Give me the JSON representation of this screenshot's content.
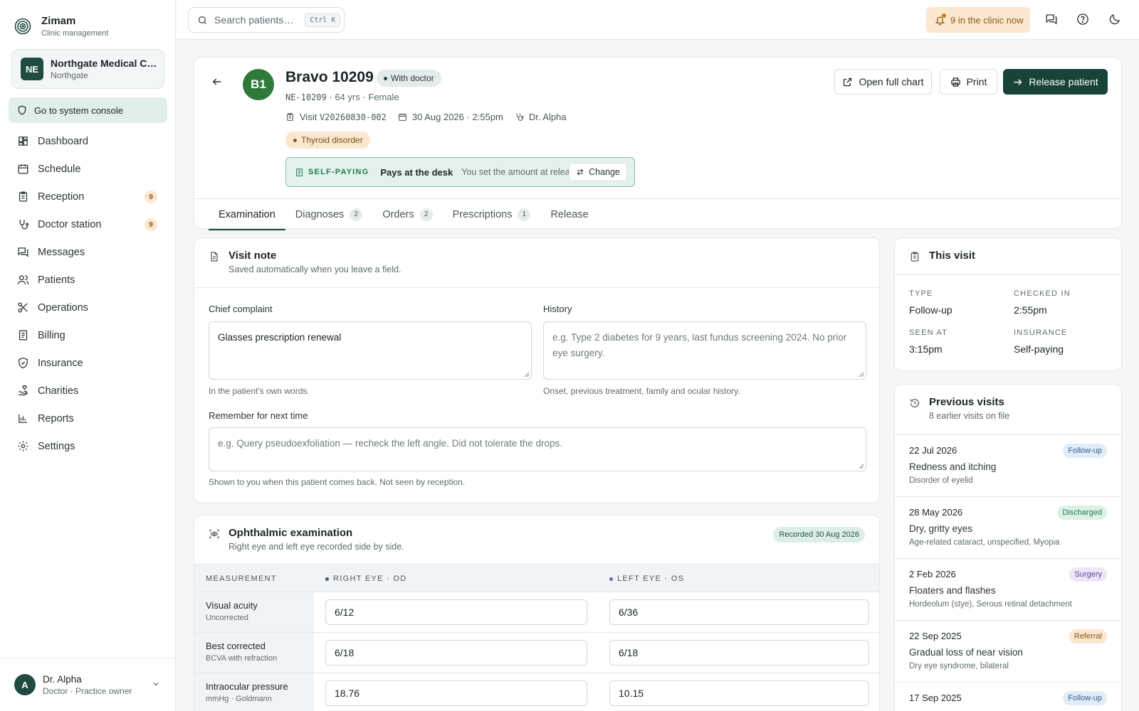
{
  "brand": {
    "name": "Zimam",
    "subtitle": "Clinic management"
  },
  "org": {
    "initials": "NE",
    "name": "Northgate Medical Ce…",
    "location": "Northgate"
  },
  "console_label": "Go to system console",
  "nav": [
    {
      "label": "Dashboard",
      "icon": "dashboard-icon",
      "badge": ""
    },
    {
      "label": "Schedule",
      "icon": "calendar-icon",
      "badge": ""
    },
    {
      "label": "Reception",
      "icon": "clipboard-icon",
      "badge": "9"
    },
    {
      "label": "Doctor station",
      "icon": "stethoscope-icon",
      "badge": "9"
    },
    {
      "label": "Messages",
      "icon": "messages-icon",
      "badge": ""
    },
    {
      "label": "Patients",
      "icon": "users-icon",
      "badge": ""
    },
    {
      "label": "Operations",
      "icon": "scissors-icon",
      "badge": ""
    },
    {
      "label": "Billing",
      "icon": "receipt-icon",
      "badge": ""
    },
    {
      "label": "Insurance",
      "icon": "shield-check-icon",
      "badge": ""
    },
    {
      "label": "Charities",
      "icon": "hand-heart-icon",
      "badge": ""
    },
    {
      "label": "Reports",
      "icon": "bar-chart-icon",
      "badge": ""
    },
    {
      "label": "Settings",
      "icon": "gear-icon",
      "badge": ""
    }
  ],
  "user": {
    "initial": "A",
    "name": "Dr. Alpha",
    "role": "Doctor · Practice owner"
  },
  "topbar": {
    "search_placeholder": "Search patients…",
    "search_shortcut": "Ctrl K",
    "clinic_now": "9 in the clinic now"
  },
  "patient": {
    "initials": "B1",
    "name": "Bravo 10209",
    "status": "With doctor",
    "mrn": "NE-10209",
    "demographics": "· 64 yrs · Female",
    "visit_label": "Visit",
    "visit_id": "V20260830-002",
    "visit_datetime": "30 Aug 2026 · 2:55pm",
    "doctor": "Dr. Alpha",
    "condition": "Thyroid disorder",
    "payer_tag": "SELF-PAYING",
    "payer_main": "Pays at the desk",
    "payer_sub": "You set the amount at release",
    "payer_change": "Change"
  },
  "actions": {
    "open_chart": "Open full chart",
    "print": "Print",
    "release": "Release patient"
  },
  "tabs": [
    {
      "label": "Examination",
      "count": ""
    },
    {
      "label": "Diagnoses",
      "count": "2"
    },
    {
      "label": "Orders",
      "count": "2"
    },
    {
      "label": "Prescriptions",
      "count": "1"
    },
    {
      "label": "Release",
      "count": ""
    }
  ],
  "visit_note": {
    "title": "Visit note",
    "subtitle": "Saved automatically when you leave a field.",
    "chief_label": "Chief complaint",
    "chief_value": "Glasses prescription renewal",
    "chief_hint": "In the patient's own words.",
    "history_label": "History",
    "history_placeholder": "e.g. Type 2 diabetes for 9 years, last fundus screening 2024. No prior eye surgery.",
    "history_hint": "Onset, previous treatment, family and ocular history.",
    "remember_label": "Remember for next time",
    "remember_placeholder": "e.g. Query pseudoexfoliation — recheck the left angle. Did not tolerate the drops.",
    "remember_hint": "Shown to you when this patient comes back. Not seen by reception."
  },
  "exam": {
    "title": "Ophthalmic examination",
    "subtitle": "Right eye and left eye recorded side by side.",
    "recorded": "Recorded 30 Aug 2026",
    "col_measurement": "MEASUREMENT",
    "col_right": "RIGHT EYE · OD",
    "col_left": "LEFT EYE · OS",
    "right_color": "#2f5f86",
    "left_color": "#6f5bb8",
    "rows": [
      {
        "name": "Visual acuity",
        "sub": "Uncorrected",
        "od": "6/12",
        "os": "6/36"
      },
      {
        "name": "Best corrected",
        "sub": "BCVA with refraction",
        "od": "6/18",
        "os": "6/18"
      },
      {
        "name": "Intraocular pressure",
        "sub": "mmHg · Goldmann",
        "od": "18.76",
        "os": "10.15"
      }
    ]
  },
  "this_visit": {
    "title": "This visit",
    "type_label": "TYPE",
    "type_value": "Follow-up",
    "checked_label": "CHECKED IN",
    "checked_value": "2:55pm",
    "seen_label": "SEEN AT",
    "seen_value": "3:15pm",
    "insurance_label": "INSURANCE",
    "insurance_value": "Self-paying"
  },
  "previous": {
    "title": "Previous visits",
    "subtitle": "8 earlier visits on file",
    "items": [
      {
        "date": "22 Jul 2026",
        "title": "Redness and itching",
        "dx": "Disorder of eyelid",
        "badge": "Follow-up",
        "badge_bg": "#e0edf8",
        "badge_fg": "#2f5f86"
      },
      {
        "date": "28 May 2026",
        "title": "Dry, gritty eyes",
        "dx": "Age-related cataract, unspecified, Myopia",
        "badge": "Discharged",
        "badge_bg": "#ddf0e6",
        "badge_fg": "#1f7a57"
      },
      {
        "date": "2 Feb 2026",
        "title": "Floaters and flashes",
        "dx": "Hordeolum (stye), Serous retinal detachment",
        "badge": "Surgery",
        "badge_bg": "#ece6f7",
        "badge_fg": "#5b4699"
      },
      {
        "date": "22 Sep 2025",
        "title": "Gradual loss of near vision",
        "dx": "Dry eye syndrome, bilateral",
        "badge": "Referral",
        "badge_bg": "#fbe7cf",
        "badge_fg": "#8a5a17"
      },
      {
        "date": "17 Sep 2025",
        "title": "",
        "dx": "",
        "badge": "Follow-up",
        "badge_bg": "#e0edf8",
        "badge_fg": "#2f5f86"
      }
    ]
  }
}
